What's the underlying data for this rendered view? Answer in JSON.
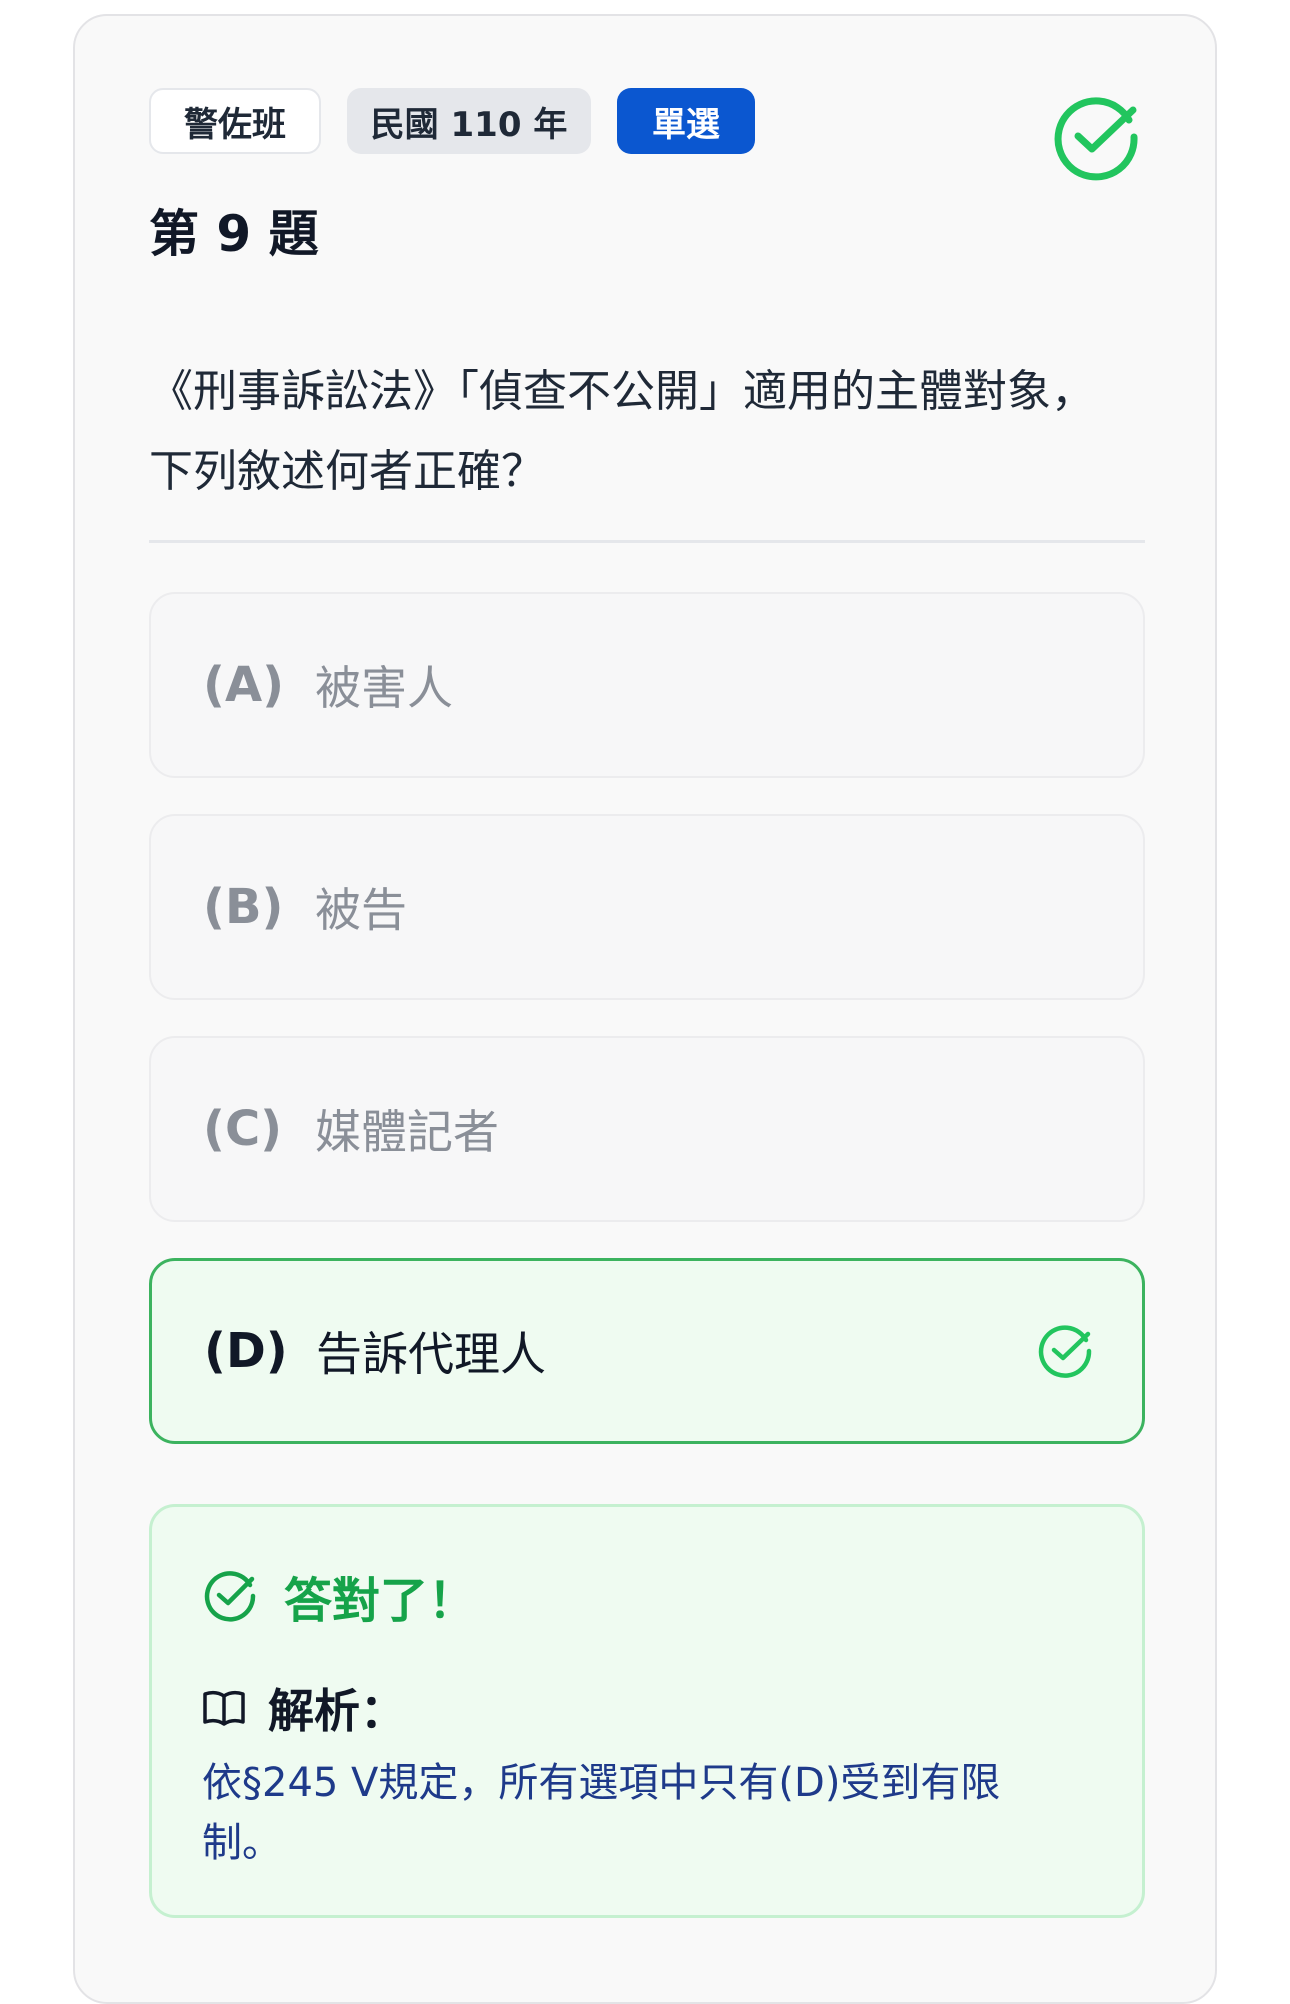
{
  "tags": {
    "class": "警佐班",
    "year": "民國 110 年",
    "type": "單選"
  },
  "question": {
    "number": "第 9 題",
    "text": "《刑事訴訟法》「偵查不公開」適用的主體對象，下列敘述何者正確？"
  },
  "options": [
    {
      "letter": "(A)",
      "text": "被害人",
      "correct": false
    },
    {
      "letter": "(B)",
      "text": "被告",
      "correct": false
    },
    {
      "letter": "(C)",
      "text": "媒體記者",
      "correct": false
    },
    {
      "letter": "(D)",
      "text": "告訴代理人",
      "correct": true
    }
  ],
  "feedback": {
    "result": "答對了！",
    "explanation_label": "解析：",
    "explanation": "依§245 V規定，所有選項中只有(D)受到有限制。"
  },
  "icons": {
    "status": "check-circle-icon",
    "option_correct": "check-circle-icon",
    "result": "check-circle-icon",
    "explanation": "book-open-icon"
  },
  "colors": {
    "accent_blue": "#0b57d0",
    "correct_green": "#22c55e",
    "correct_bg": "#effbf1",
    "explanation_text": "#1e3a8a"
  }
}
